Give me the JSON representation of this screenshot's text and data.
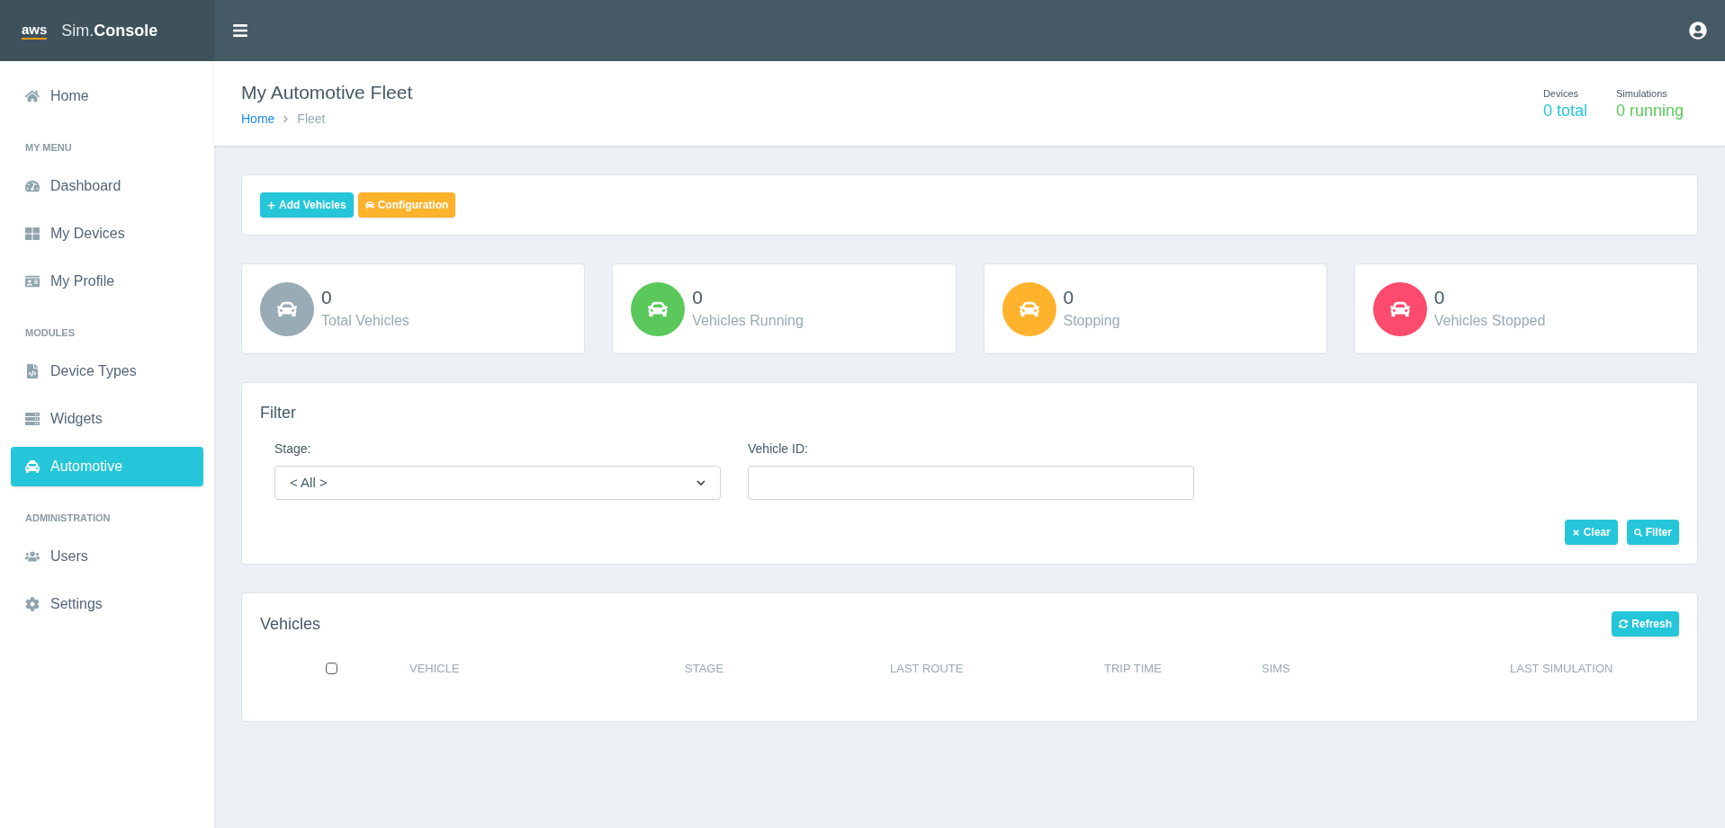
{
  "topbar": {
    "logo_mark": "aws",
    "brand_prefix": "Sim.",
    "brand_name": "Console"
  },
  "sidebar": {
    "items": [
      {
        "kind": "item",
        "label": "Home",
        "selected": false
      },
      {
        "kind": "section",
        "label": "MY MENU"
      },
      {
        "kind": "item",
        "label": "Dashboard",
        "selected": false
      },
      {
        "kind": "item",
        "label": "My Devices",
        "selected": false
      },
      {
        "kind": "item",
        "label": "My Profile",
        "selected": false
      },
      {
        "kind": "section",
        "label": "MODULES"
      },
      {
        "kind": "item",
        "label": "Device Types",
        "selected": false
      },
      {
        "kind": "item",
        "label": "Widgets",
        "selected": false
      },
      {
        "kind": "item",
        "label": "Automotive",
        "selected": true
      },
      {
        "kind": "section",
        "label": "ADMINISTRATION"
      },
      {
        "kind": "item",
        "label": "Users",
        "selected": false
      },
      {
        "kind": "item",
        "label": "Settings",
        "selected": false
      }
    ]
  },
  "header": {
    "title": "My Automotive Fleet",
    "breadcrumb": [
      "Home",
      "Fleet"
    ],
    "stats": [
      {
        "label": "Devices",
        "value": "0 total",
        "color": "#26c6da"
      },
      {
        "label": "Simulations",
        "value": "0 running",
        "color": "#5ac85a"
      }
    ]
  },
  "actions": [
    {
      "kind": "add",
      "label": "Add Vehicles",
      "color": "#26c6da"
    },
    {
      "kind": "config",
      "label": "Configuration",
      "color": "#ffb22b"
    }
  ],
  "stat_cards": [
    {
      "value": "0",
      "label": "Total Vehicles",
      "color": "#99abb4"
    },
    {
      "value": "0",
      "label": "Vehicles Running",
      "color": "#5ac85a"
    },
    {
      "value": "0",
      "label": "Stopping",
      "color": "#ffb22b"
    },
    {
      "value": "0",
      "label": "Vehicles Stopped",
      "color": "#fc4b6c"
    }
  ],
  "filter": {
    "title": "Filter",
    "stage": {
      "label": "Stage:",
      "value": "< All >"
    },
    "vehicle_id": {
      "label": "Vehicle ID:"
    },
    "buttons": [
      {
        "kind": "clear",
        "label": "Clear"
      },
      {
        "kind": "filter",
        "label": "Filter"
      }
    ]
  },
  "vehicles": {
    "title": "Vehicles",
    "refresh": "Refresh",
    "select_all_checked": false,
    "columns": [
      "VEHICLE",
      "STAGE",
      "LAST ROUTE",
      "TRIP TIME",
      "SIMS",
      "LAST SIMULATION"
    ]
  }
}
